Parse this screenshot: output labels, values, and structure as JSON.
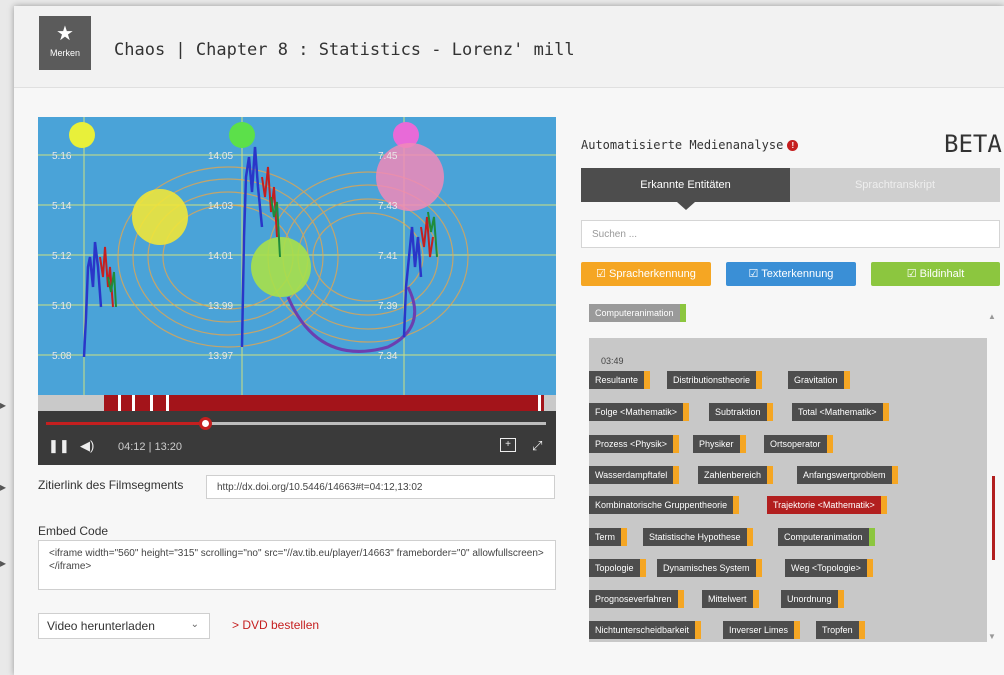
{
  "header": {
    "bookmark_label": "Merken",
    "title": "Chaos | Chapter 8 : Statistics - Lorenz' mill"
  },
  "video": {
    "overlay_numbers_left": [
      "5.16",
      "5.14",
      "5.12",
      "5.10",
      "5.08"
    ],
    "overlay_numbers_mid": [
      "14.05",
      "14.03",
      "14.01",
      "13.99",
      "13.97"
    ],
    "overlay_numbers_right": [
      "7.45",
      "7.43",
      "7.41",
      "7.39",
      "7.34"
    ],
    "progress_fraction": 0.317,
    "time_display": "04:12 | 13:20"
  },
  "citation": {
    "label": "Zitierlink des Filmsegments",
    "value": "http://dx.doi.org/10.5446/14663#t=04:12,13:02"
  },
  "embed": {
    "label": "Embed Code",
    "value": "<iframe width=\"560\" height=\"315\" scrolling=\"no\" src=\"//av.tib.eu/player/14663\" frameborder=\"0\" allowfullscreen></iframe>"
  },
  "download": {
    "selected": "Video herunterladen",
    "dvd_link": "> DVD bestellen"
  },
  "analysis": {
    "title": "Automatisierte Medienanalyse",
    "beta": "BETA",
    "tabs": [
      "Erkannte Entitäten",
      "Sprachtranskript"
    ],
    "search_placeholder": "Suchen ...",
    "filters": [
      "Spracherkennung",
      "Texterkennung",
      "Bildinhalt"
    ],
    "top_tag": "Computeranimation",
    "segment_time": "03:49",
    "tags": [
      "Resultante",
      "Distributionstheorie",
      "Gravitation",
      "Folge <Mathematik>",
      "Subtraktion",
      "Total <Mathematik>",
      "Prozess <Physik>",
      "Physiker",
      "Ortsoperator",
      "Wasserdampftafel",
      "Zahlenbereich",
      "Anfangswertproblem",
      "Kombinatorische Gruppentheorie",
      "Trajektorie <Mathematik>",
      "Term",
      "Statistische Hypothese",
      "Computeranimation",
      "Topologie",
      "Dynamisches System",
      "Weg <Topologie>",
      "Prognoseverfahren",
      "Mittelwert",
      "Unordnung",
      "Nichtunterscheidbarkeit",
      "Inverser Limes",
      "Tropfen"
    ]
  },
  "colors": {
    "accent_red": "#c51f1f",
    "orange": "#f5a623",
    "blue": "#3a8fd6",
    "green": "#8cc63f"
  }
}
